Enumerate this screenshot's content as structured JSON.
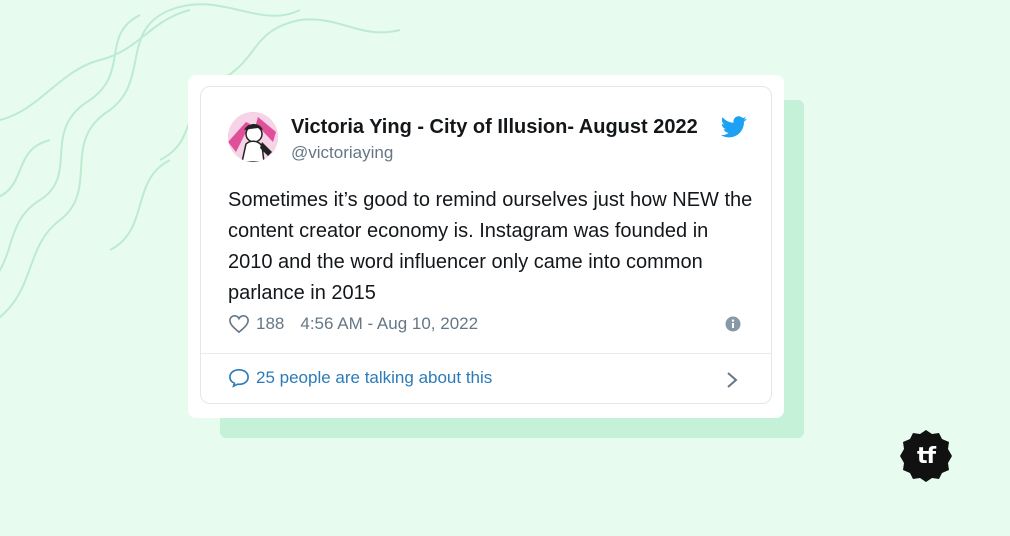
{
  "tweet": {
    "name": "Victoria Ying - City of Illusion- August 2022",
    "handle": "@victoriaying",
    "text": "Sometimes it’s good to remind ourselves just how NEW the content creator economy is. Instagram was founded in 2010 and the word influencer only came into common parlance in 2015",
    "likes": "188",
    "timestamp": "4:56 AM - Aug 10, 2022",
    "conversation": "25 people are talking about this"
  },
  "brand": {
    "logo_text": "tf"
  },
  "colors": {
    "background": "#e8fbef",
    "twitter_blue": "#1da1f2",
    "link": "#2b7bb9"
  },
  "icons": [
    "twitter-bird-icon",
    "heart-icon",
    "info-icon",
    "comment-bubble-icon",
    "chevron-right-icon"
  ]
}
